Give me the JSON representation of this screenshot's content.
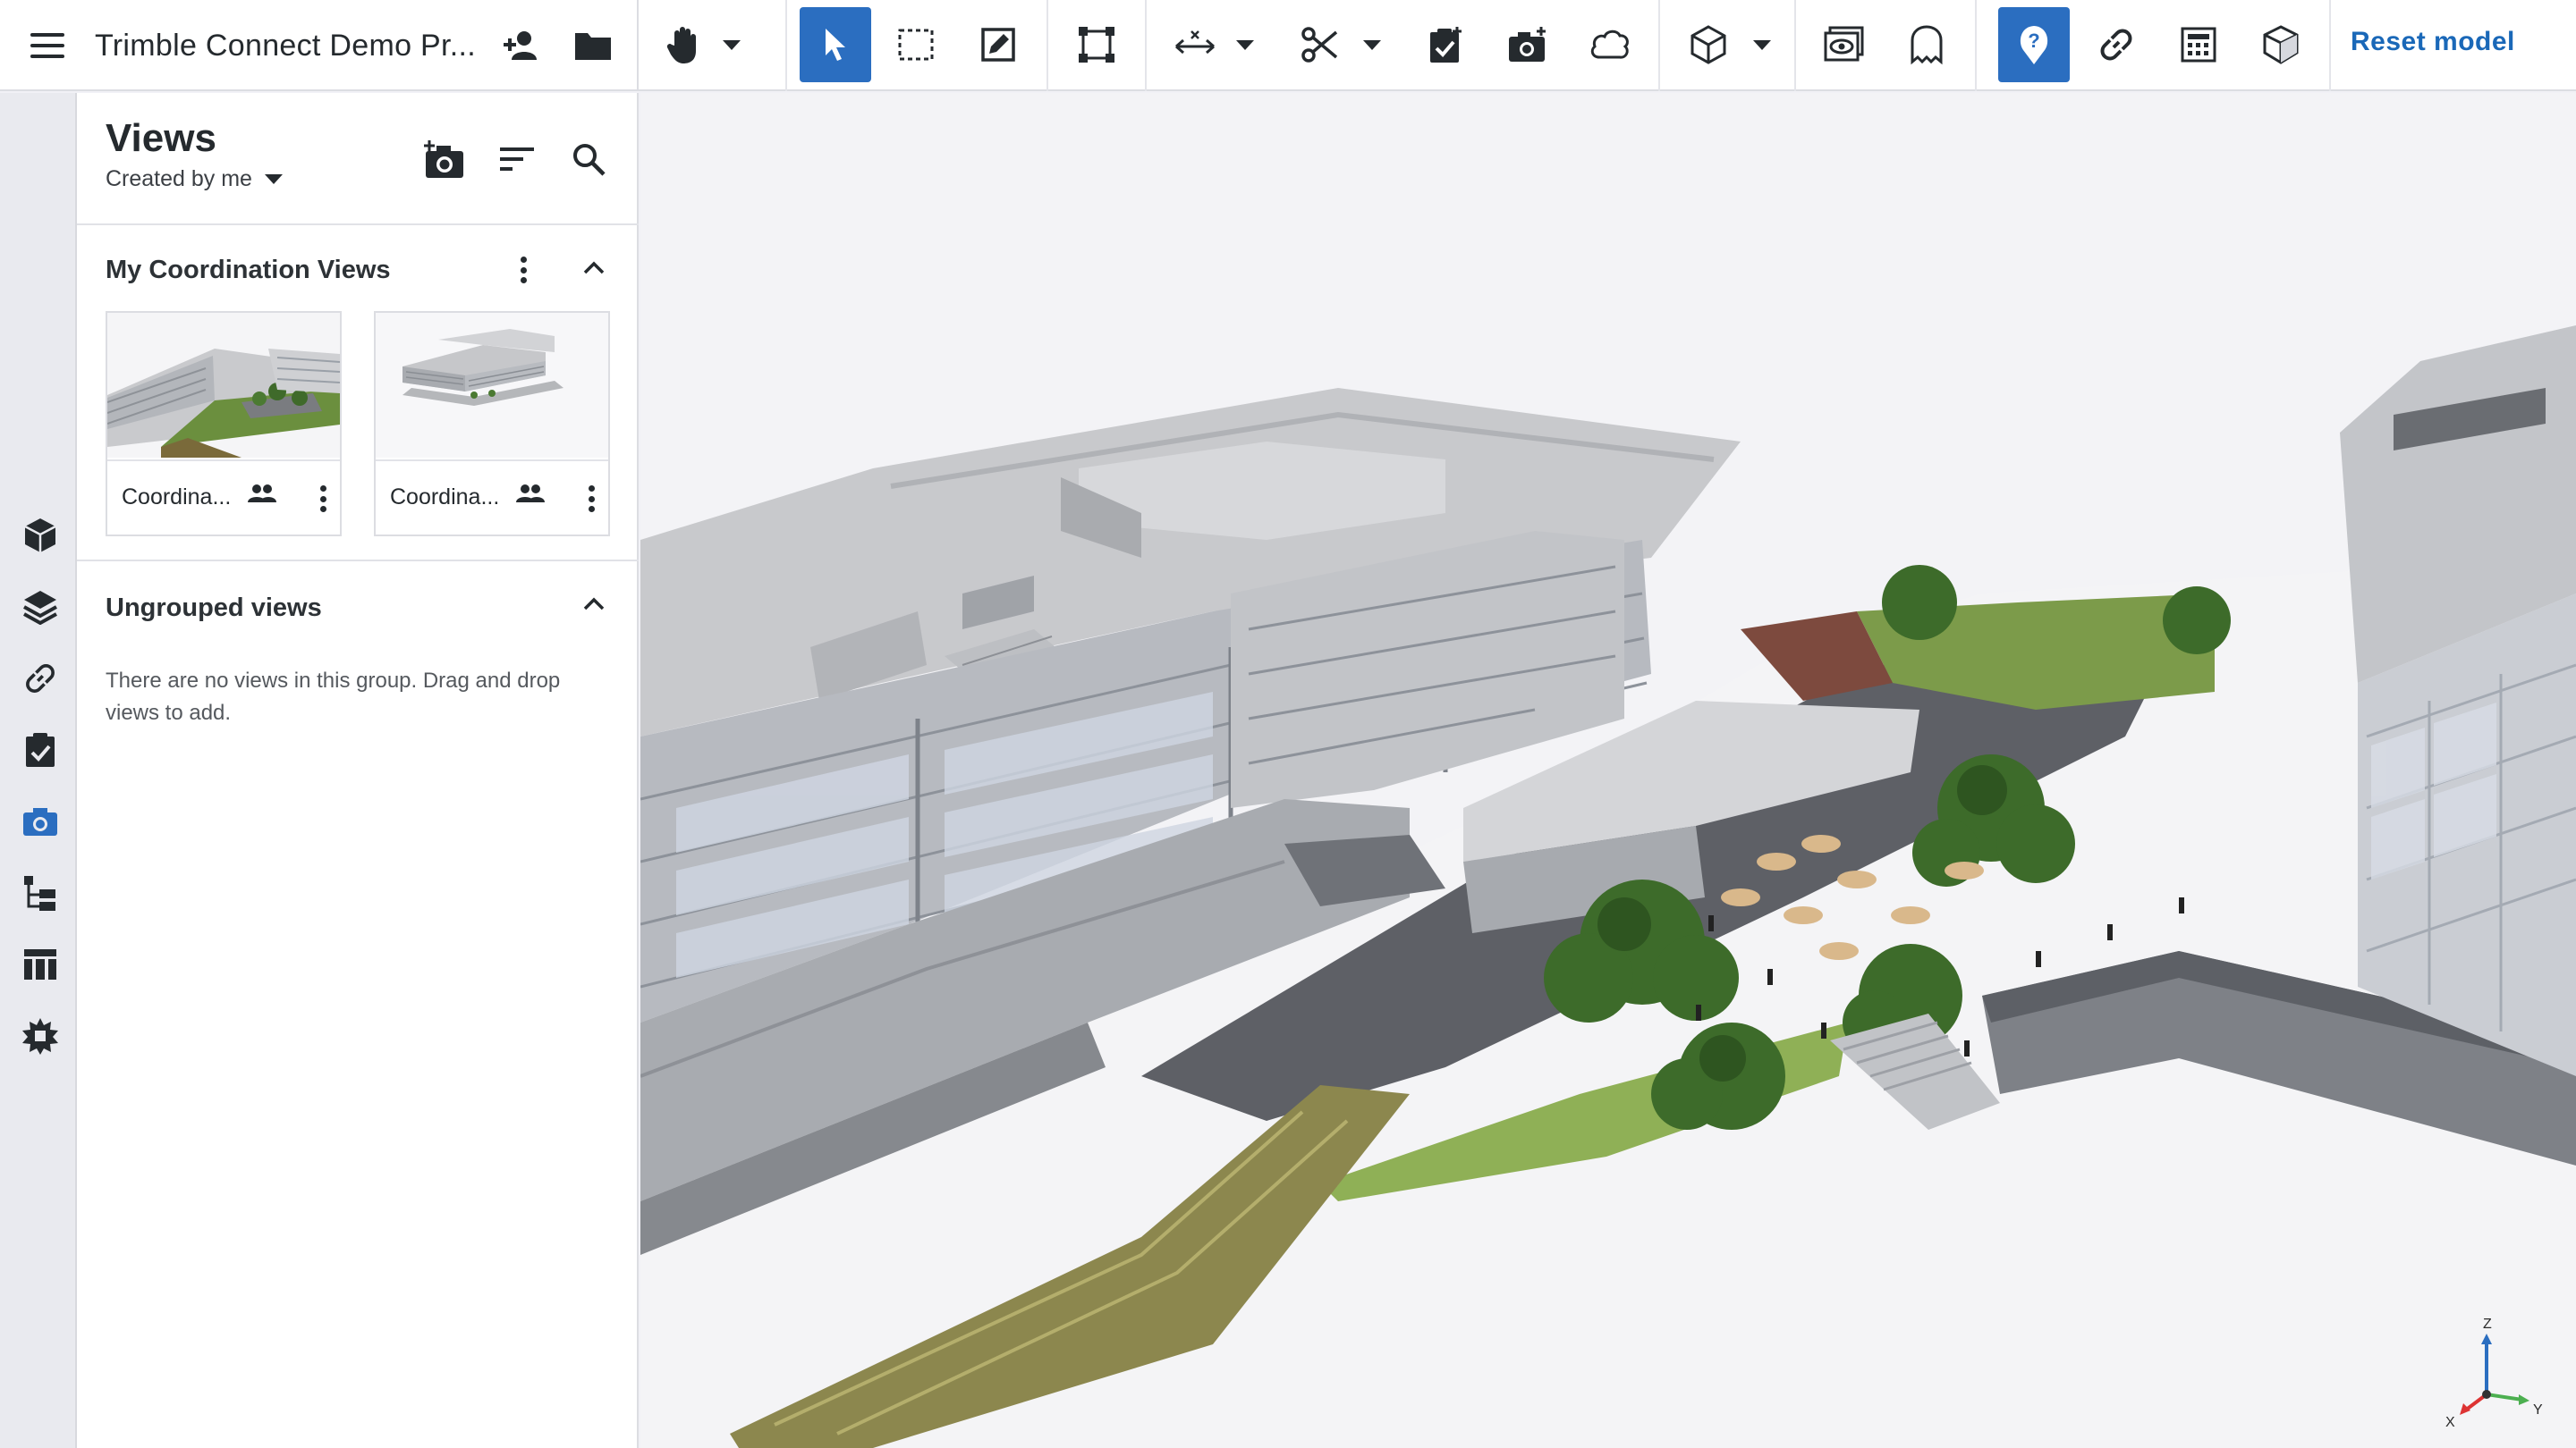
{
  "header": {
    "project_title": "Trimble Connect Demo Pr...",
    "add_user_icon": "person-add-icon",
    "folder_icon": "folder-icon"
  },
  "toolbar": {
    "tools": [
      {
        "name": "pan-tool",
        "icon": "hand-icon",
        "active": false,
        "has_menu": true
      },
      {
        "name": "select-tool",
        "icon": "cursor-arrow-icon",
        "active": true,
        "has_menu": false
      },
      {
        "name": "box-select-tool",
        "icon": "dashed-rectangle-icon",
        "active": false,
        "has_menu": false
      },
      {
        "name": "markup-tool",
        "icon": "pencil-square-icon",
        "active": false,
        "has_menu": false
      },
      {
        "name": "fit-view-tool",
        "icon": "frame-corners-icon",
        "active": false,
        "has_menu": false
      },
      {
        "name": "measure-tool",
        "icon": "measure-arrows-icon",
        "active": false,
        "has_menu": true
      },
      {
        "name": "clip-tool",
        "icon": "scissors-icon",
        "active": false,
        "has_menu": true
      },
      {
        "name": "add-todo-tool",
        "icon": "clipboard-check-icon",
        "active": false,
        "has_menu": false
      },
      {
        "name": "add-view-tool",
        "icon": "camera-plus-icon",
        "active": false,
        "has_menu": false
      },
      {
        "name": "cloud-markup-tool",
        "icon": "cloud-icon",
        "active": false,
        "has_menu": false
      },
      {
        "name": "projection-tool",
        "icon": "cube-icon",
        "active": false,
        "has_menu": true
      },
      {
        "name": "visibility-tool",
        "icon": "eye-screen-icon",
        "active": false,
        "has_menu": false
      },
      {
        "name": "ghost-tool",
        "icon": "ghost-icon",
        "active": false,
        "has_menu": false
      },
      {
        "name": "help-tool",
        "icon": "question-pin-icon",
        "active": true,
        "has_menu": false
      },
      {
        "name": "link-tool",
        "icon": "link-icon",
        "active": false,
        "has_menu": false
      },
      {
        "name": "calculator-tool",
        "icon": "calculator-icon",
        "active": false,
        "has_menu": false
      },
      {
        "name": "model-cube-tool",
        "icon": "half-cube-icon",
        "active": false,
        "has_menu": false
      }
    ],
    "reset_label": "Reset model",
    "accent_color": "#2b6ec0",
    "reset_color": "#1a68b8"
  },
  "rail": {
    "items": [
      {
        "name": "models",
        "icon": "cube-icon",
        "active": false
      },
      {
        "name": "layers",
        "icon": "layers-icon",
        "active": false
      },
      {
        "name": "links",
        "icon": "link-icon",
        "active": false
      },
      {
        "name": "todos",
        "icon": "clipboard-check-icon",
        "active": false
      },
      {
        "name": "views",
        "icon": "camera-icon",
        "active": true
      },
      {
        "name": "tree",
        "icon": "tree-list-icon",
        "active": false
      },
      {
        "name": "table",
        "icon": "table-icon",
        "active": false
      },
      {
        "name": "clash",
        "icon": "clash-icon",
        "active": false
      }
    ]
  },
  "panel": {
    "title": "Views",
    "filter_label": "Created by me",
    "groups": [
      {
        "title": "My Coordination Views",
        "cards": [
          {
            "label": "Coordina...",
            "shared_icon": "people-icon"
          },
          {
            "label": "Coordina...",
            "shared_icon": "people-icon"
          }
        ]
      },
      {
        "title": "Ungrouped views",
        "empty_message": "There are no views in this group. Drag and drop views to add."
      }
    ]
  },
  "viewport": {
    "axes": {
      "x": "X",
      "y": "Y",
      "z": "Z"
    }
  }
}
